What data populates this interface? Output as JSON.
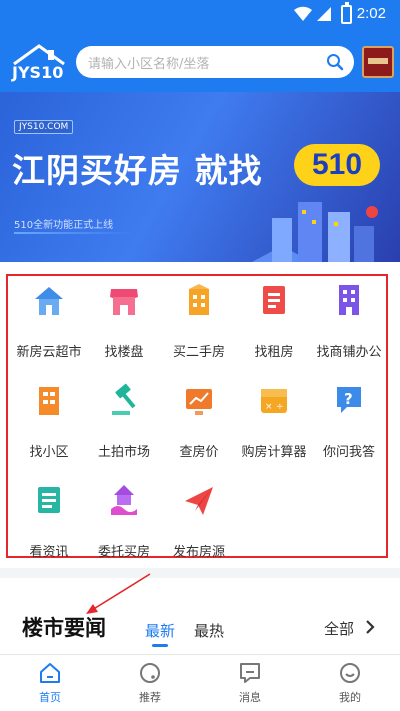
{
  "status": {
    "time": "2:02",
    "battery": ""
  },
  "header": {
    "logo_text": "JYS10",
    "search_placeholder": "请输入小区名称/坐落"
  },
  "banner": {
    "site": "JYS10.COM",
    "headline": "江阴买好房 就找",
    "badge": "510",
    "tagline": "510全新功能正式上线"
  },
  "menu": [
    {
      "label": "新房云超市",
      "icon": "house-icon",
      "color": "#3f8de8"
    },
    {
      "label": "找楼盘",
      "icon": "store-icon",
      "color": "#ef4a74"
    },
    {
      "label": "买二手房",
      "icon": "building-icon",
      "color": "#f7a326"
    },
    {
      "label": "找租房",
      "icon": "document-icon",
      "color": "#ef4b48"
    },
    {
      "label": "找商铺办公",
      "icon": "office-icon",
      "color": "#7b55e8"
    },
    {
      "label": "找小区",
      "icon": "apartment-icon",
      "color": "#f58a2a"
    },
    {
      "label": "土拍市场",
      "icon": "gavel-icon",
      "color": "#1fb59b"
    },
    {
      "label": "查房价",
      "icon": "price-chart-icon",
      "color": "#f07a2c"
    },
    {
      "label": "购房计算器",
      "icon": "calculator-icon",
      "color": "#f5a623"
    },
    {
      "label": "你问我答",
      "icon": "question-icon",
      "color": "#3d8be8"
    },
    {
      "label": "看资讯",
      "icon": "news-icon",
      "color": "#27b6a4"
    },
    {
      "label": "委托买房",
      "icon": "entrust-icon",
      "color": "#a44ce0"
    },
    {
      "label": "发布房源",
      "icon": "paper-plane-icon",
      "color": "#ef4444"
    }
  ],
  "news": {
    "title": "楼市要闻",
    "tab_latest": "最新",
    "tab_hot": "最热",
    "all": "全部"
  },
  "tabbar": [
    {
      "label": "首页",
      "icon": "home-icon"
    },
    {
      "label": "推荐",
      "icon": "recommend-icon"
    },
    {
      "label": "消息",
      "icon": "message-icon"
    },
    {
      "label": "我的",
      "icon": "profile-icon"
    }
  ],
  "colors": {
    "brand": "#1e7cf0",
    "highlight": "#e5262a",
    "badge": "#ffd21a"
  }
}
